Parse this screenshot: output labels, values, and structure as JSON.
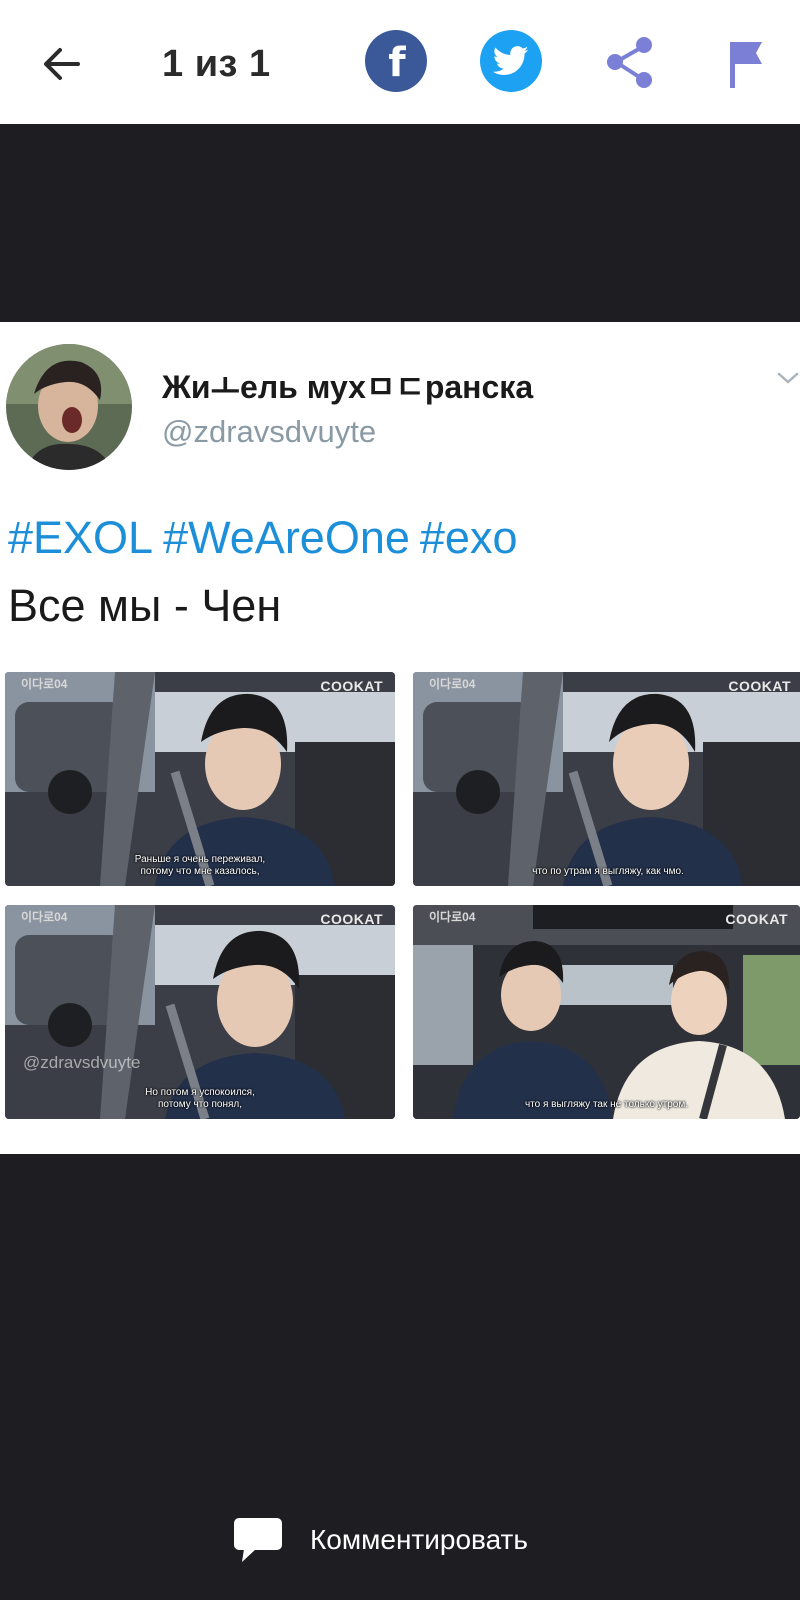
{
  "header": {
    "back_icon": "arrow-left-icon",
    "counter": "1 из 1",
    "facebook_icon": "facebook-icon",
    "twitter_icon": "twitter-icon",
    "share_icon": "share-icon",
    "flag_icon": "flag-icon",
    "facebook_letter": "f"
  },
  "tweet": {
    "display_name": "Жиㅗель мухㅁㄷранска",
    "handle": "@zdravsdvuyte",
    "hashtags": [
      "#EXOL",
      "#WeAreOne",
      "#exo"
    ],
    "text": "Все мы - Чен",
    "media": [
      {
        "logo": "이다로04",
        "watermark": "COOKAT",
        "subtitle_line1": "Раньше я очень переживал,",
        "subtitle_line2": "потому что мне казалось,"
      },
      {
        "logo": "이다로04",
        "watermark": "COOKAT",
        "subtitle_line1": "что по утрам я выгляжу, как чмо.",
        "subtitle_line2": ""
      },
      {
        "logo": "이다로04",
        "watermark": "COOKAT",
        "username_mark": "@zdravsdvuyte",
        "subtitle_line1": "Но потом я успокоился,",
        "subtitle_line2": "потому что понял,"
      },
      {
        "logo": "이다로04",
        "watermark": "COOKAT",
        "subtitle_line1": "что я выгляжу так не только утром.",
        "subtitle_line2": ""
      }
    ]
  },
  "footer": {
    "comment_icon": "speech-bubble-icon",
    "comment_label": "Комментировать"
  },
  "colors": {
    "background": "#1e1d22",
    "facebook": "#3b5998",
    "twitter": "#1da1f2",
    "accent_icon": "#7b7fd6",
    "hashtag": "#1d8fd8"
  }
}
